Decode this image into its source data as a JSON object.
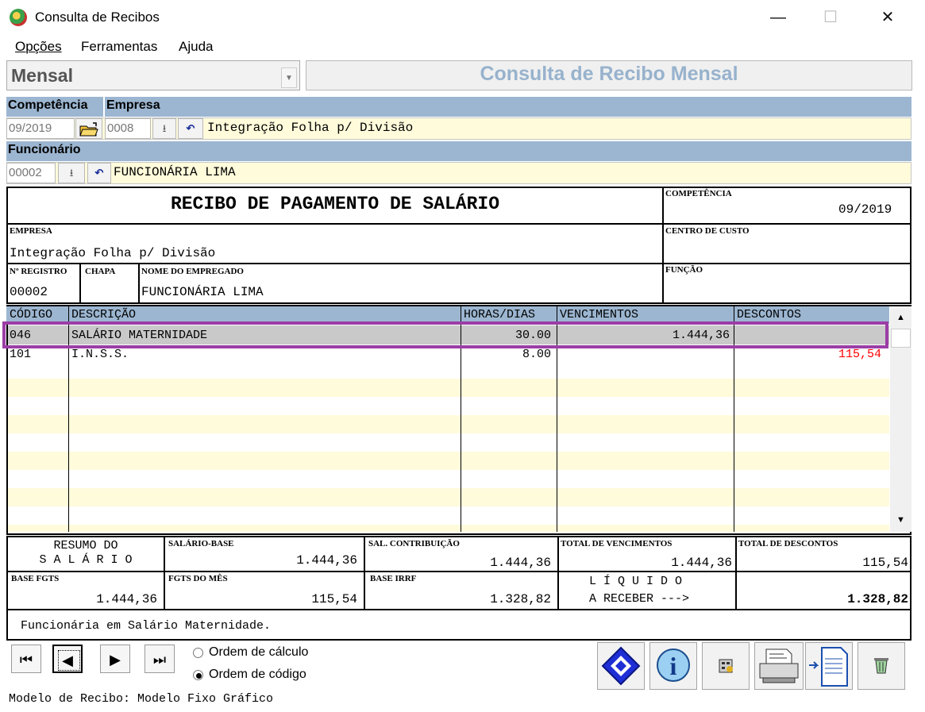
{
  "window": {
    "title": "Consulta de Recibos",
    "minimize": "—",
    "maximize": "☐",
    "close": "✕"
  },
  "menu": {
    "opcoes": "Opções",
    "ferramentas": "Ferramentas",
    "ajuda": "Ajuda"
  },
  "mode_select": {
    "value": "Mensal"
  },
  "panel_title": "Consulta de Recibo Mensal",
  "filters": {
    "competencia_label": "Competência",
    "empresa_label": "Empresa",
    "competencia_value": "09/2019",
    "empresa_code": "0008",
    "empresa_name": "Integração Folha p/ Divisão",
    "funcionario_label": "Funcionário",
    "funcionario_code": "00002",
    "funcionario_name": "FUNCIONÁRIA LIMA"
  },
  "receipt": {
    "title": "RECIBO DE PAGAMENTO DE SALÁRIO",
    "competencia_label": "COMPETÊNCIA",
    "competencia_value": "09/2019",
    "empresa_label": "EMPRESA",
    "empresa_value": "Integração Folha p/ Divisão",
    "centro_custo_label": "CENTRO DE CUSTO",
    "registro_label": "Nº REGISTRO",
    "registro_value": "00002",
    "chapa_label": "CHAPA",
    "nome_label": "NOME DO EMPREGADO",
    "nome_value": "FUNCIONÁRIA LIMA",
    "funcao_label": "FUNÇÃO"
  },
  "grid": {
    "headers": {
      "codigo": "CÓDIGO",
      "descricao": "DESCRIÇÃO",
      "horas": "HORAS/DIAS",
      "vencimentos": "VENCIMENTOS",
      "descontos": "DESCONTOS"
    },
    "rows": [
      {
        "codigo": "046",
        "descricao": "SALÁRIO MATERNIDADE",
        "horas": "30.00",
        "vencimentos": "1.444,36",
        "descontos": ""
      },
      {
        "codigo": "101",
        "descricao": "I.N.S.S.",
        "horas": "8.00",
        "vencimentos": "",
        "descontos": "115,54"
      }
    ],
    "discount_color": "#ff0000",
    "highlight_color": "#9b3ea6"
  },
  "summary": {
    "resumo_line1": "RESUMO DO",
    "resumo_line2": "S A L Á R I O",
    "salario_base_label": "SALÁRIO-BASE",
    "salario_base_value": "1.444,36",
    "sal_contrib_label": "SAL. CONTRIBUIÇÃO",
    "sal_contrib_value": "1.444,36",
    "total_venc_label": "TOTAL DE VENCIMENTOS",
    "total_venc_value": "1.444,36",
    "total_desc_label": "TOTAL DE DESCONTOS",
    "total_desc_value": "115,54",
    "base_fgts_label": "BASE FGTS",
    "base_fgts_value": "1.444,36",
    "fgts_mes_label": "FGTS DO MÊS",
    "fgts_mes_value": "115,54",
    "base_irrf_label": "BASE IRRF",
    "base_irrf_value": "1.328,82",
    "liquido_line1": "L Í Q U I D O",
    "liquido_line2": "A RECEBER --->",
    "liquido_value": "1.328,82",
    "message": "Funcionária em Salário Maternidade."
  },
  "order": {
    "calculo": "Ordem de cálculo",
    "codigo": "Ordem de código",
    "selected": "codigo"
  },
  "footer": {
    "modelo": "Modelo de Recibo: Modelo Fixo Gráfico"
  },
  "icons": [
    "app-icon",
    "folder-open-icon",
    "download-arrow-icon",
    "undo-icon",
    "first-record-icon",
    "previous-record-icon",
    "next-record-icon",
    "last-record-icon",
    "navigate-diamond-icon",
    "info-icon",
    "calculator-icon",
    "printer-icon",
    "export-document-icon",
    "trash-icon"
  ]
}
